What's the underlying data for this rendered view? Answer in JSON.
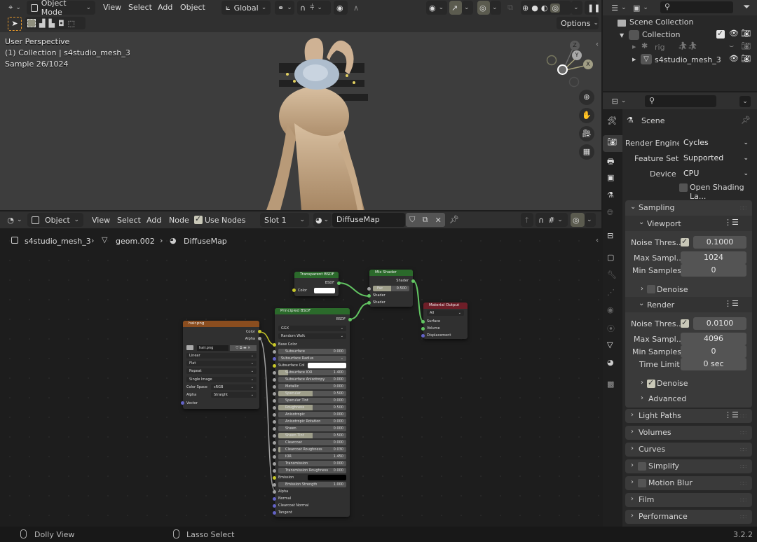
{
  "viewport": {
    "header": {
      "editor_icon": "3d-viewport-icon",
      "mode": "Object Mode",
      "menus": [
        "View",
        "Select",
        "Add",
        "Object"
      ],
      "transform_orientation": "Global",
      "options_label": "Options"
    },
    "overlay": {
      "perspective": "User Perspective",
      "collection_info": "(1) Collection | s4studio_mesh_3",
      "sample": "Sample 26/1024"
    },
    "gizmo": {
      "x": "X",
      "y": "Y",
      "z": "Z"
    }
  },
  "node_editor": {
    "header": {
      "object_mode": "Object",
      "menus": [
        "View",
        "Select",
        "Add",
        "Node"
      ],
      "use_nodes_label": "Use Nodes",
      "use_nodes_checked": true,
      "slot": "Slot 1",
      "material_name": "DiffuseMap"
    },
    "breadcrumb": [
      "s4studio_mesh_3",
      "geom.002",
      "DiffuseMap"
    ],
    "nodes": {
      "image_texture": {
        "title": "hair.png",
        "outputs": [
          "Color",
          "Alpha"
        ],
        "image": "hair.png",
        "interpolation": "Linear",
        "projection": "Flat",
        "extension": "Repeat",
        "source": "Single Image",
        "color_space_label": "Color Space",
        "color_space": "sRGB",
        "alpha_label": "Alpha",
        "alpha": "Straight",
        "input": "Vector"
      },
      "transparent": {
        "title": "Transparent BSDF",
        "output": "BSDF",
        "color_label": "Color",
        "color": "#ffffff"
      },
      "mix": {
        "title": "Mix Shader",
        "output": "Shader",
        "fac_label": "Fac",
        "fac_value": "0.500",
        "inputs": [
          "Shader",
          "Shader"
        ]
      },
      "output": {
        "title": "Material Output",
        "target": "All",
        "inputs": [
          "Surface",
          "Volume",
          "Displacement"
        ]
      },
      "principled": {
        "title": "Principled BSDF",
        "output": "BSDF",
        "distribution": "GGX",
        "subsurface_method": "Random Walk",
        "base_color_label": "Base Color",
        "subsurface_radius": "Subsurface Radius",
        "subsurface_col_label": "Subsurface Col",
        "params": [
          {
            "label": "Subsurface",
            "value": "0.000",
            "fill": 0
          },
          {
            "label": "Subsurface IOR",
            "value": "1.400",
            "fill": 0.14
          },
          {
            "label": "Subsurface Anisotropy",
            "value": "0.000",
            "fill": 0
          },
          {
            "label": "Metallic",
            "value": "0.000",
            "fill": 0
          },
          {
            "label": "Specular",
            "value": "0.500",
            "fill": 0.5
          },
          {
            "label": "Specular Tint",
            "value": "0.000",
            "fill": 0
          },
          {
            "label": "Roughness",
            "value": "0.500",
            "fill": 0.5
          },
          {
            "label": "Anisotropic",
            "value": "0.000",
            "fill": 0
          },
          {
            "label": "Anisotropic Rotation",
            "value": "0.000",
            "fill": 0
          },
          {
            "label": "Sheen",
            "value": "0.000",
            "fill": 0
          },
          {
            "label": "Sheen Tint",
            "value": "0.500",
            "fill": 0.5
          },
          {
            "label": "Clearcoat",
            "value": "0.000",
            "fill": 0
          },
          {
            "label": "Clearcoat Roughness",
            "value": "0.030",
            "fill": 0.03
          },
          {
            "label": "IOR",
            "value": "1.450",
            "fill": 0
          },
          {
            "label": "Transmission",
            "value": "0.000",
            "fill": 0
          },
          {
            "label": "Transmission Roughness",
            "value": "0.000",
            "fill": 0
          }
        ],
        "emission_label": "Emission",
        "emission_strength_label": "Emission Strength",
        "emission_strength": "1.000",
        "tail_inputs": [
          "Alpha",
          "Normal",
          "Clearcoat Normal",
          "Tangent"
        ]
      }
    }
  },
  "outliner": {
    "search_placeholder": "",
    "scene_collection": "Scene Collection",
    "items": [
      {
        "name": "Collection",
        "type": "collection"
      },
      {
        "name": "rig",
        "type": "armature"
      },
      {
        "name": "s4studio_mesh_3",
        "type": "mesh"
      }
    ]
  },
  "properties": {
    "context": "Scene",
    "render_engine_label": "Render Engine",
    "render_engine": "Cycles",
    "feature_set_label": "Feature Set",
    "feature_set": "Supported",
    "device_label": "Device",
    "device": "CPU",
    "osl_label": "Open Shading La...",
    "sampling": {
      "title": "Sampling",
      "viewport": {
        "title": "Viewport",
        "noise_label": "Noise Thres...",
        "noise": "0.1000",
        "max_label": "Max Sampl...",
        "max": "1024",
        "min_label": "Min Samples",
        "min": "0",
        "denoise_label": "Denoise"
      },
      "render": {
        "title": "Render",
        "noise_label": "Noise Thres...",
        "noise": "0.0100",
        "max_label": "Max Sampl...",
        "max": "4096",
        "min_label": "Min Samples",
        "min": "0",
        "time_label": "Time Limit",
        "time": "0 sec",
        "denoise_label": "Denoise"
      },
      "advanced": "Advanced"
    },
    "panels": [
      "Light Paths",
      "Volumes",
      "Curves",
      "Simplify",
      "Motion Blur",
      "Film",
      "Performance"
    ]
  },
  "status_bar": {
    "left_hint": "Dolly View",
    "middle_hint": "Lasso Select",
    "version": "3.2.2"
  }
}
